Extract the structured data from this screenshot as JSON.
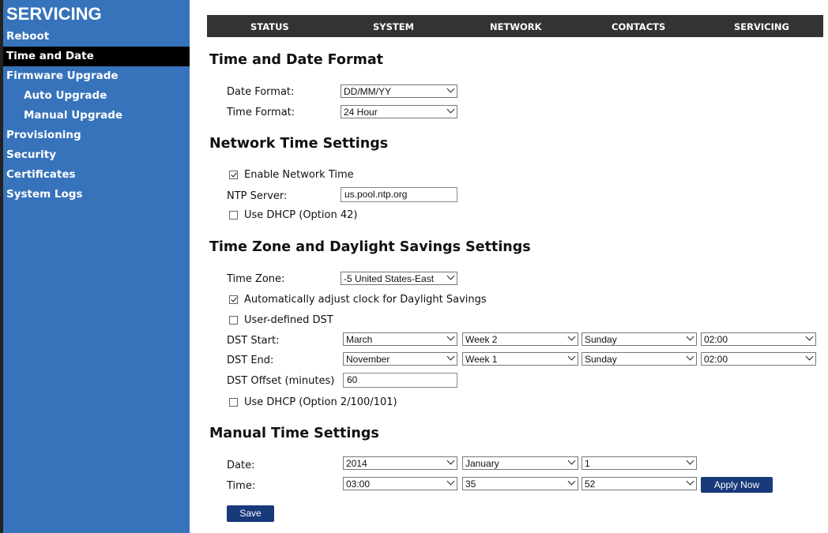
{
  "sidebar": {
    "title": "SERVICING",
    "items": [
      {
        "label": "Reboot"
      },
      {
        "label": "Time and Date"
      },
      {
        "label": "Firmware Upgrade"
      },
      {
        "label": "Auto Upgrade"
      },
      {
        "label": "Manual Upgrade"
      },
      {
        "label": "Provisioning"
      },
      {
        "label": "Security"
      },
      {
        "label": "Certificates"
      },
      {
        "label": "System Logs"
      }
    ],
    "active_item": "Time and Date"
  },
  "topnav": {
    "tabs": [
      {
        "label": "STATUS"
      },
      {
        "label": "SYSTEM"
      },
      {
        "label": "NETWORK"
      },
      {
        "label": "CONTACTS"
      },
      {
        "label": "SERVICING"
      }
    ]
  },
  "format": {
    "heading": "Time and Date Format",
    "date_label": "Date Format:",
    "date_value": "DD/MM/YY",
    "time_label": "Time Format:",
    "time_value": "24 Hour"
  },
  "network_time": {
    "heading": "Network Time Settings",
    "enable_label": "Enable Network Time",
    "enable_checked": true,
    "ntp_label": "NTP Server:",
    "ntp_value": "us.pool.ntp.org",
    "dhcp_label": "Use DHCP (Option 42)",
    "dhcp_checked": false
  },
  "timezone": {
    "heading": "Time Zone and Daylight Savings Settings",
    "tz_label": "Time Zone:",
    "tz_value": "-5 United States-East",
    "auto_dst_label": "Automatically adjust clock for Daylight Savings",
    "auto_dst_checked": true,
    "user_dst_label": "User-defined DST",
    "user_dst_checked": false,
    "dst_start_label": "DST Start:",
    "dst_start": {
      "month": "March",
      "week": "Week 2",
      "day": "Sunday",
      "time": "02:00"
    },
    "dst_end_label": "DST End:",
    "dst_end": {
      "month": "November",
      "week": "Week 1",
      "day": "Sunday",
      "time": "02:00"
    },
    "offset_label": "DST Offset (minutes)",
    "offset_value": "60",
    "dhcp_label": "Use DHCP (Option 2/100/101)",
    "dhcp_checked": false
  },
  "manual": {
    "heading": "Manual Time Settings",
    "date_label": "Date:",
    "year": "2014",
    "month": "January",
    "day": "1",
    "time_label": "Time:",
    "hour": "03:00",
    "minute": "35",
    "second": "52",
    "apply_label": "Apply Now"
  },
  "save_label": "Save",
  "colors": {
    "sidebar_bg": "#3773bb",
    "active_item_bg": "#000000",
    "topbar_bg": "#333333",
    "button_bg": "#18397a"
  }
}
